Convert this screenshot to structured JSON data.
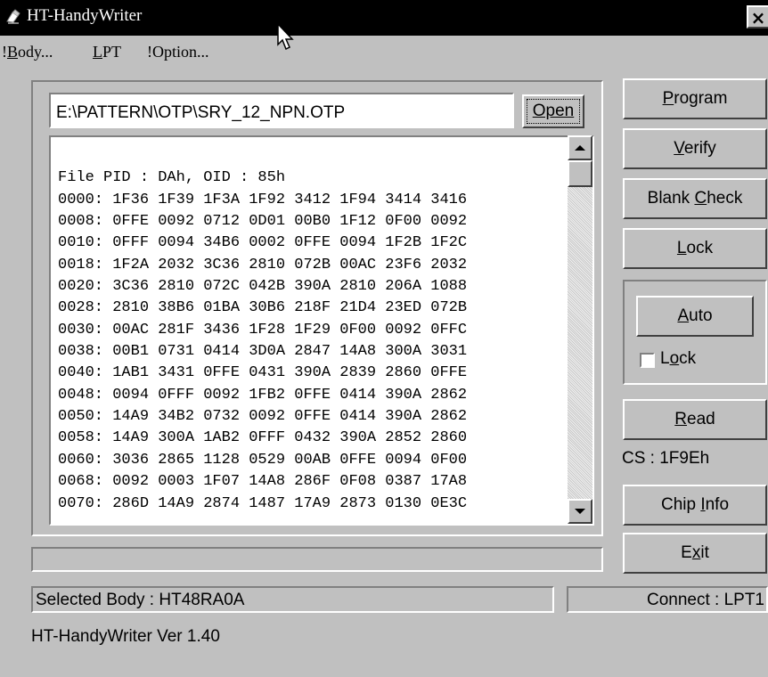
{
  "window": {
    "title": "HT-HandyWriter",
    "close_label": "×"
  },
  "menu": {
    "items": [
      {
        "prefix": "!",
        "accel": "B",
        "rest": "ody..."
      },
      {
        "prefix": "",
        "accel": "L",
        "rest": "PT"
      },
      {
        "prefix": "!",
        "accel": "",
        "rest": "Option..."
      }
    ]
  },
  "file": {
    "path": "E:\\PATTERN\\OTP\\SRY_12_NPN.OTP",
    "open_label": "Open"
  },
  "hex_view": {
    "lines": [
      "File PID : DAh, OID : 85h",
      "0000: 1F36 1F39 1F3A 1F92 3412 1F94 3414 3416",
      "0008: 0FFE 0092 0712 0D01 00B0 1F12 0F00 0092",
      "0010: 0FFF 0094 34B6 0002 0FFE 0094 1F2B 1F2C",
      "0018: 1F2A 2032 3C36 2810 072B 00AC 23F6 2032",
      "0020: 3C36 2810 072C 042B 390A 2810 206A 1088",
      "0028: 2810 38B6 01BA 30B6 218F 21D4 23ED 072B",
      "0030: 00AC 281F 3436 1F28 1F29 0F00 0092 0FFC",
      "0038: 00B1 0731 0414 3D0A 2847 14A8 300A 3031",
      "0040: 1AB1 3431 0FFE 0431 390A 2839 2860 0FFE",
      "0048: 0094 0FFF 0092 1FB2 0FFE 0414 390A 2862",
      "0050: 14A9 34B2 0732 0092 0FFE 0414 390A 2862",
      "0058: 14A9 300A 1AB2 0FFF 0432 390A 2852 2860",
      "0060: 3036 2865 1128 0529 00AB 0FFE 0094 0F00",
      "0068: 0092 0003 1F07 14A8 286F 0F08 0387 17A8",
      "0070: 286D 14A9 2874 1487 17A9 2873 0130 0E3C"
    ]
  },
  "buttons": {
    "program": {
      "accel": "P",
      "rest": "rogram"
    },
    "verify": {
      "accel": "V",
      "rest": "erify"
    },
    "blank_check": {
      "pre": "Blank ",
      "accel": "C",
      "rest": "heck"
    },
    "lock": {
      "accel": "L",
      "rest": "ock"
    },
    "auto": {
      "accel": "A",
      "rest": "uto"
    },
    "read": {
      "accel": "R",
      "rest": "ead"
    },
    "chip_info": {
      "pre": "Chip ",
      "accel": "I",
      "rest": "nfo"
    },
    "exit": {
      "pre": "E",
      "accel": "x",
      "rest": "it"
    }
  },
  "auto_lock": {
    "pre": "L",
    "accel": "o",
    "rest": "ck",
    "checked": false
  },
  "checksum": "CS : 1F9Eh",
  "status": {
    "selected_body": "Selected Body : HT48RA0A",
    "connect": "Connect : LPT1"
  },
  "version": "HT-HandyWriter Ver 1.40"
}
